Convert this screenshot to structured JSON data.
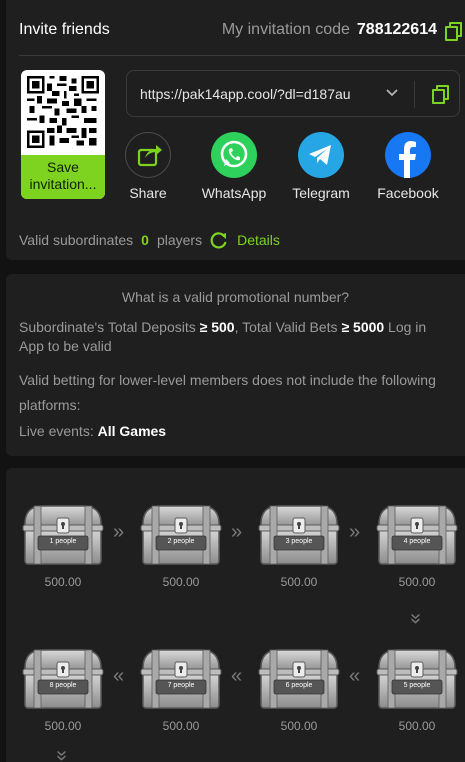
{
  "invite": {
    "title": "Invite friends",
    "code_label": "My invitation code",
    "code": "788122614",
    "save_label": "Save invitation...",
    "link": "https://pak14app.cool/?dl=d187au",
    "shares": [
      {
        "label": "Share",
        "icon": "share-icon",
        "color": "#1f1f1f"
      },
      {
        "label": "WhatsApp",
        "icon": "whatsapp-icon",
        "color": "#2ed15c"
      },
      {
        "label": "Telegram",
        "icon": "telegram-icon",
        "color": "#27a6e5"
      },
      {
        "label": "Facebook",
        "icon": "facebook-icon",
        "color": "#1877f2"
      }
    ],
    "valid_label": "Valid subordinates",
    "valid_count": "0",
    "players_label": "players",
    "details_label": "Details",
    "accent": "#7ed321"
  },
  "rules": {
    "title": "What is a valid promotional number?",
    "line1_a": "Subordinate's Total Deposits ",
    "line1_b": "≥ 500",
    "line1_c": ",  Total Valid Bets ",
    "line1_d": "≥ 5000",
    "line1_e": " Log in App to be valid",
    "line2": "Valid betting for lower-level members does not include the following platforms:",
    "line3_a": "Live events: ",
    "line3_b": "All Games"
  },
  "chests": [
    {
      "label": "1 people",
      "amount": "500.00"
    },
    {
      "label": "2 people",
      "amount": "500.00"
    },
    {
      "label": "3 people",
      "amount": "500.00"
    },
    {
      "label": "4 people",
      "amount": "500.00"
    },
    {
      "label": "5 people",
      "amount": "500.00"
    },
    {
      "label": "6 people",
      "amount": "500.00"
    },
    {
      "label": "7 people",
      "amount": "500.00"
    },
    {
      "label": "8 people",
      "amount": "500.00"
    }
  ]
}
